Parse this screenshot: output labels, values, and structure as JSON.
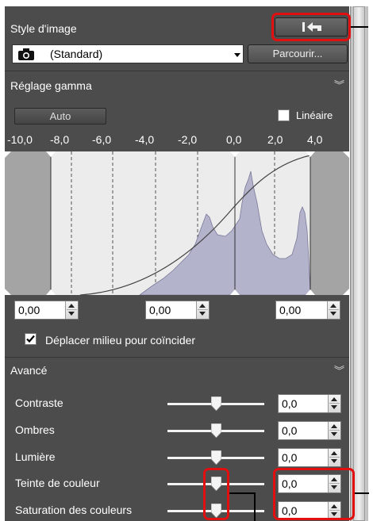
{
  "style_section": {
    "title": "Style d'image",
    "picture_style_value": "(Standard)",
    "browse_button": "Parcourir...",
    "reset_icon": "reset-arrow-icon",
    "camera_icon": "camera-icon"
  },
  "gamma_section": {
    "title": "Réglage gamma",
    "auto_button": "Auto",
    "linear_label": "Linéaire",
    "linear_checked": false,
    "axis_ticks": [
      "-10,0",
      "-8,0",
      "-6,0",
      "-4,0",
      "-2,0",
      "0,0",
      "2,0",
      "4,0"
    ],
    "shadow_value": "0,00",
    "midpoint_value": "0,00",
    "highlight_value": "0,00",
    "move_midpoint_label": "Déplacer milieu pour coïncider",
    "move_midpoint_checked": true
  },
  "advanced_section": {
    "title": "Avancé",
    "sliders": [
      {
        "label": "Contraste",
        "value": "0,0",
        "level": 0.5
      },
      {
        "label": "Ombres",
        "value": "0,0",
        "level": 0.5
      },
      {
        "label": "Lumière",
        "value": "0,0",
        "level": 0.5
      },
      {
        "label": "Teinte de couleur",
        "value": "0,0",
        "level": 0.5
      },
      {
        "label": "Saturation des couleurs",
        "value": "0,0",
        "level": 0.5
      }
    ]
  },
  "colors": {
    "panel_bg": "#4c4c4c",
    "highlight_red": "#e10f0f",
    "histogram_fill": "#b3b3cc"
  }
}
